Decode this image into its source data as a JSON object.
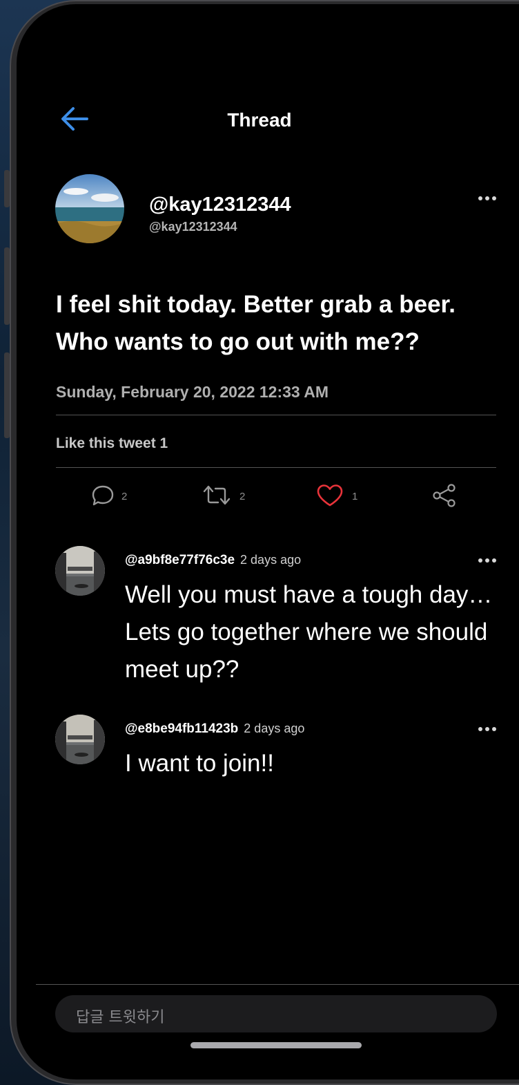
{
  "header": {
    "title": "Thread"
  },
  "tweet": {
    "display_name": "@kay12312344",
    "handle": "@kay12312344",
    "text": "I feel shit today. Better grab a beer. Who wants to go out with me??",
    "date": "Sunday, February 20, 2022 12:33 AM",
    "likes_text": "Like this tweet 1"
  },
  "actions": {
    "reply_count": "2",
    "retweet_count": "2",
    "like_count": "1"
  },
  "comments": [
    {
      "user": "@a9bf8e77f76c3e",
      "time": "2 days ago",
      "text": "Well you must have a tough day… Lets go together where we should meet up??"
    },
    {
      "user": "@e8be94fb11423b",
      "time": "2 days ago",
      "text": "I want to join!!"
    }
  ],
  "reply": {
    "placeholder": "답글 트윗하기"
  },
  "colors": {
    "accent_blue": "#3d8ee8",
    "like_red": "#e8333a",
    "background": "#000000"
  },
  "icons": [
    "back-arrow-icon",
    "more-icon",
    "reply-icon",
    "retweet-icon",
    "heart-icon",
    "share-icon"
  ]
}
